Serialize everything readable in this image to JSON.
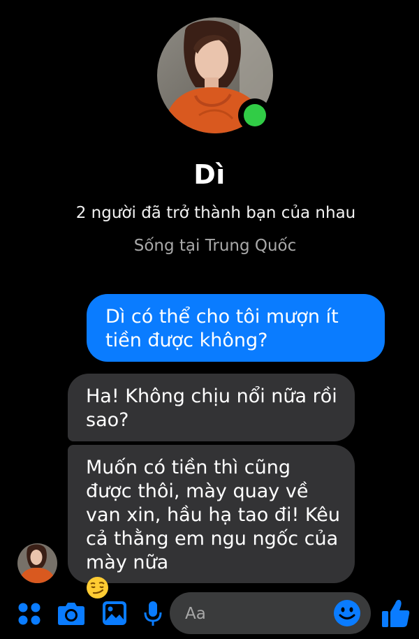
{
  "contact": {
    "name": "Dì",
    "mutual_friends": "2 người đã trở thành bạn của nhau",
    "lives_in": "Sống tại Trung Quốc",
    "online": true
  },
  "messages": [
    {
      "direction": "outgoing",
      "text": "Dì có thể cho tôi mượn ít tiền được không?"
    },
    {
      "direction": "incoming",
      "text": "Ha! Không chịu nổi nữa rồi sao?"
    },
    {
      "direction": "incoming",
      "text": "Muốn có tiền thì cũng được thôi, mày quay về van xin, hầu hạ tao đi! Kêu cả thằng em ngu ngốc của mày nữa",
      "emoji": "smirking-face"
    }
  ],
  "composer": {
    "placeholder": "Aa",
    "icons": [
      "menu-grid-icon",
      "camera-icon",
      "image-icon",
      "microphone-icon",
      "emoji-icon",
      "like-thumb-icon"
    ]
  },
  "colors": {
    "background": "#000000",
    "outgoing_bubble": "#0a7cff",
    "incoming_bubble": "#333335",
    "accent": "#0a7cff",
    "online": "#31cc46"
  }
}
